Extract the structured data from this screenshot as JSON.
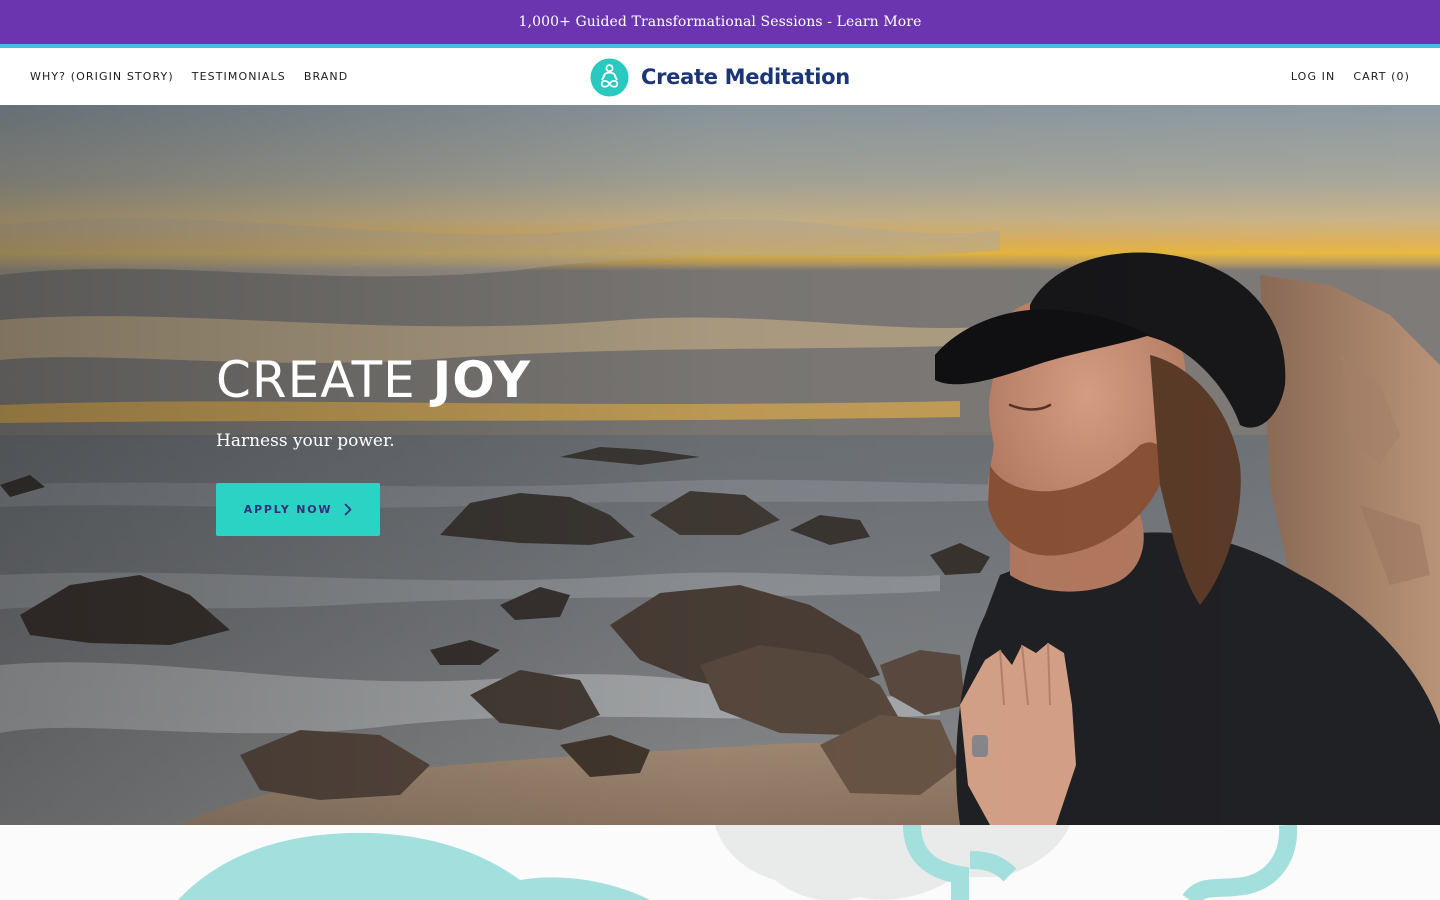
{
  "announcement": {
    "text": "1,000+ Guided Transformational Sessions - Learn More"
  },
  "header": {
    "nav_left": [
      {
        "label": "WHY? (ORIGIN STORY)"
      },
      {
        "label": "TESTIMONIALS"
      },
      {
        "label": "BRAND"
      }
    ],
    "logo_text": "Create Meditation",
    "nav_right": {
      "login": "LOG IN",
      "cart": "CART (0)"
    }
  },
  "hero": {
    "title_prefix": "CREATE",
    "title_accent": "JOY",
    "subtitle": "Harness your power.",
    "cta_label": "APPLY NOW",
    "image_subject": "man meditating with eyes closed on a rocky beach at sunset, hand on chest"
  },
  "icons": {
    "logo_mark": "meditating-figure-icon",
    "cta_arrow": "chevron-right-icon"
  },
  "colors": {
    "announcement_bg": "#6c35b0",
    "announcement_rule": "#3fc2e0",
    "logo_text": "#1b3576",
    "logo_mark": "#2ac9c0",
    "cta_bg": "#2ad3c4",
    "cta_text": "#3a2a7a",
    "decor_teal": "#a3e0dd",
    "decor_grey": "#e9eaea"
  }
}
